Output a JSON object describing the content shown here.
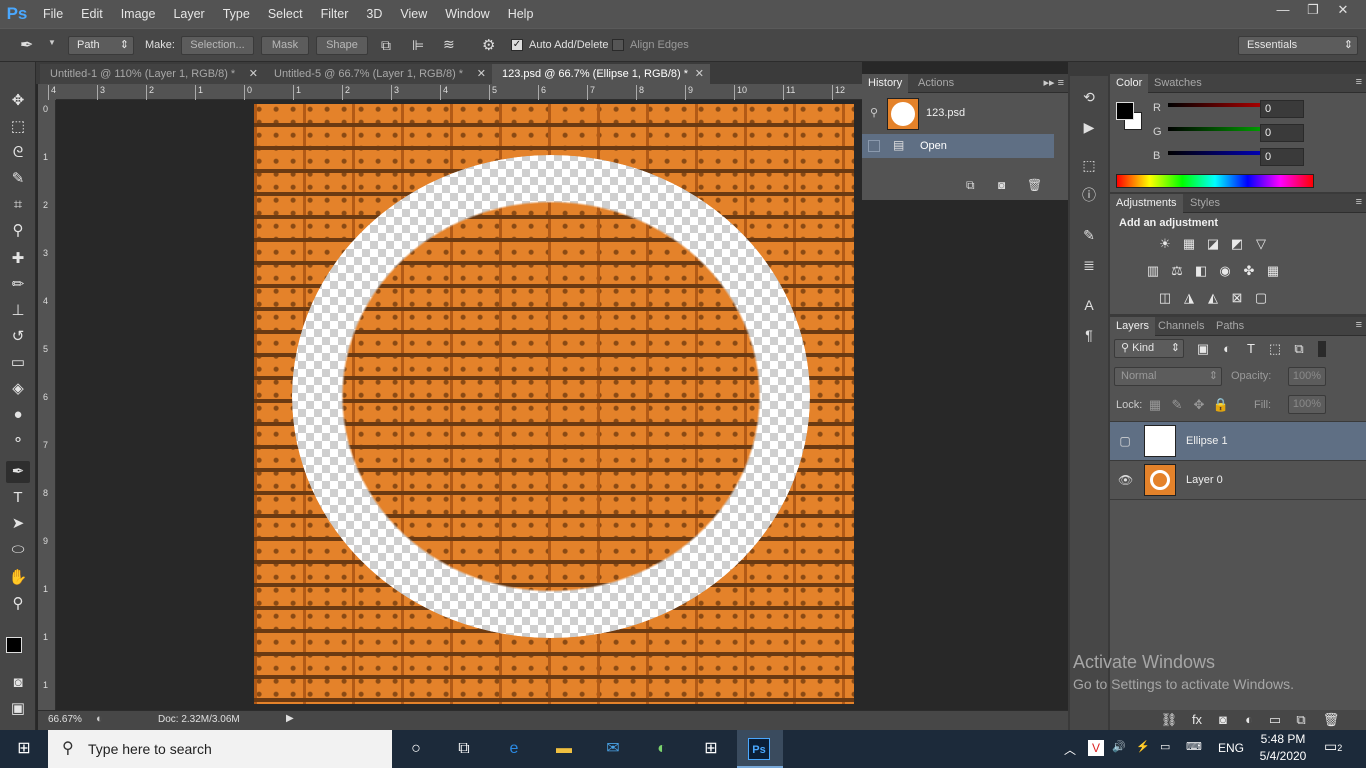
{
  "app": {
    "logo": "Ps"
  },
  "menu": [
    "File",
    "Edit",
    "Image",
    "Layer",
    "Type",
    "Select",
    "Filter",
    "3D",
    "View",
    "Window",
    "Help"
  ],
  "window_controls": {
    "minimize": "—",
    "restore": "❐",
    "close": "✕"
  },
  "options": {
    "tool_mode": "Path",
    "make_label": "Make:",
    "selection_btn": "Selection...",
    "mask_btn": "Mask",
    "shape_btn": "Shape",
    "auto_add_delete": "Auto Add/Delete",
    "align_edges": "Align Edges",
    "workspace": "Essentials"
  },
  "tabs": [
    {
      "title": "Untitled-1 @ 110% (Layer 1, RGB/8) *"
    },
    {
      "title": "Untitled-5 @ 66.7% (Layer 1, RGB/8) *"
    },
    {
      "title": "123.psd @ 66.7% (Ellipse 1, RGB/8) *"
    }
  ],
  "ruler_top": [
    "4",
    "3",
    "2",
    "1",
    "0",
    "1",
    "2",
    "3",
    "4",
    "5",
    "6",
    "7",
    "8",
    "9",
    "10",
    "11",
    "12"
  ],
  "ruler_left": [
    "0",
    "1",
    "2",
    "3",
    "4",
    "5",
    "6",
    "7",
    "8",
    "9",
    "1",
    "1",
    "1"
  ],
  "status": {
    "zoom": "66.67%",
    "doc": "Doc: 2.32M/3.06M"
  },
  "history": {
    "tabs": [
      "History",
      "Actions"
    ],
    "snapshot": "123.psd",
    "items": [
      "Open"
    ]
  },
  "color": {
    "tabs": [
      "Color",
      "Swatches"
    ],
    "channels": [
      {
        "name": "R",
        "value": "0"
      },
      {
        "name": "G",
        "value": "0"
      },
      {
        "name": "B",
        "value": "0"
      }
    ]
  },
  "adjustments": {
    "tabs": [
      "Adjustments",
      "Styles"
    ],
    "title": "Add an adjustment"
  },
  "layers": {
    "tabs": [
      "Layers",
      "Channels",
      "Paths"
    ],
    "filter": "Kind",
    "blend": "Normal",
    "opacity_label": "Opacity:",
    "opacity_value": "100%",
    "lock_label": "Lock:",
    "fill_label": "Fill:",
    "fill_value": "100%",
    "items": [
      {
        "name": "Ellipse 1"
      },
      {
        "name": "Layer 0"
      }
    ]
  },
  "watermark": {
    "line1": "Activate Windows",
    "line2": "Go to Settings to activate Windows."
  },
  "taskbar": {
    "search_placeholder": "Type here to search",
    "language": "ENG",
    "time": "5:48 PM",
    "date": "5/4/2020",
    "notifications": "2"
  }
}
